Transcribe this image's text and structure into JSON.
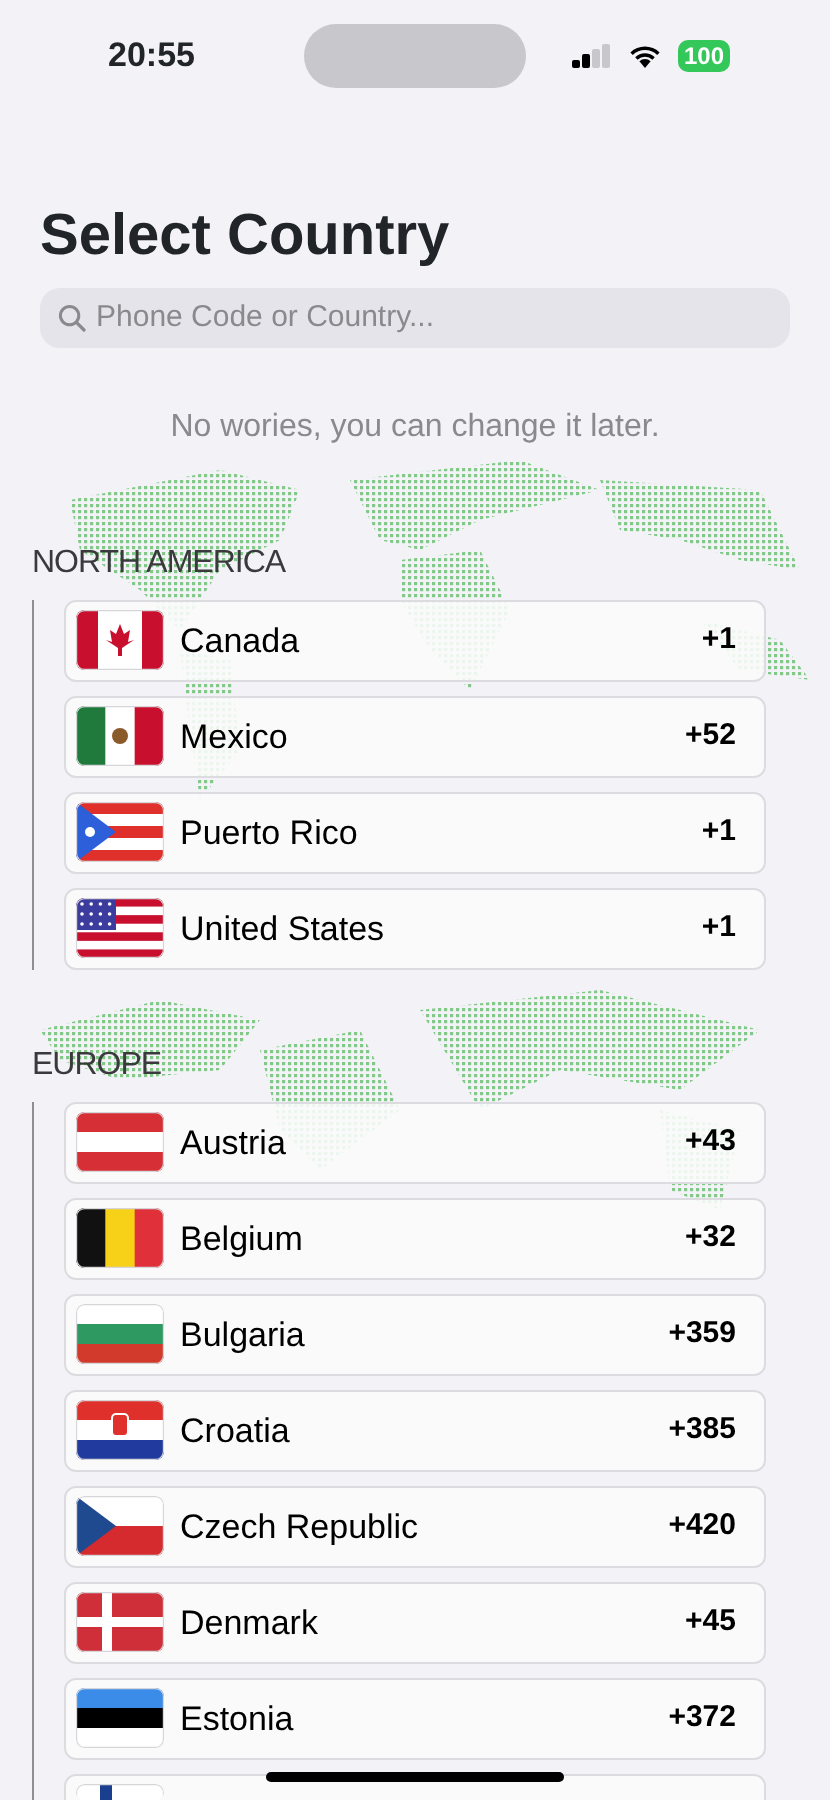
{
  "status_bar": {
    "time": "20:55",
    "battery": "100"
  },
  "title": "Select Country",
  "search": {
    "placeholder": "Phone Code or Country..."
  },
  "note": "No wories, you can change it later.",
  "sections": [
    {
      "title": "NORTH AMERICA",
      "countries": [
        {
          "kind": "ca",
          "name": "Canada",
          "code": "+1"
        },
        {
          "kind": "mx",
          "name": "Mexico",
          "code": "+52"
        },
        {
          "kind": "pr",
          "name": "Puerto Rico",
          "code": "+1"
        },
        {
          "kind": "us",
          "name": "United States",
          "code": "+1"
        }
      ]
    },
    {
      "title": "EUROPE",
      "countries": [
        {
          "kind": "at",
          "name": "Austria",
          "code": "+43"
        },
        {
          "kind": "be",
          "name": "Belgium",
          "code": "+32"
        },
        {
          "kind": "bg",
          "name": "Bulgaria",
          "code": "+359"
        },
        {
          "kind": "hr",
          "name": "Croatia",
          "code": "+385"
        },
        {
          "kind": "cz",
          "name": "Czech Republic",
          "code": "+420"
        },
        {
          "kind": "dk",
          "name": "Denmark",
          "code": "+45"
        },
        {
          "kind": "ee",
          "name": "Estonia",
          "code": "+372"
        },
        {
          "kind": "fi"
        }
      ]
    }
  ]
}
